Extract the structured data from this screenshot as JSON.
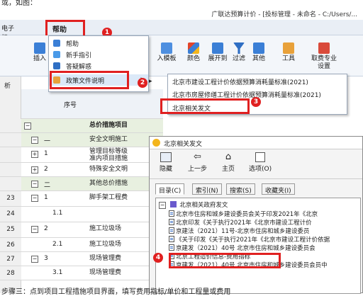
{
  "top_text": "或，如图：",
  "app_title": "广联达预算计价 - [投标管理 - 未命名 - C:/Users/...",
  "menubar": {
    "left_partial": "电子标",
    "help": "帮助",
    "f1": "F1"
  },
  "ribbon": {
    "insert": "插入",
    "template": "入模板",
    "color": "颜色",
    "expand": "展开到",
    "filter": "过滤",
    "other": "其他",
    "tools": "工具",
    "fee_setting_line1": "取费专业",
    "fee_setting_line2": "设置"
  },
  "help_menu": {
    "items": [
      "帮助",
      "新手指引",
      "答疑解惑",
      "政策文件说明"
    ]
  },
  "submenu": {
    "items": [
      "北京市建设工程计价依据预算消耗量标准(2021)",
      "北京市房屋修缮工程计价依据预算消耗量标准(2021)",
      "北京相关发文"
    ]
  },
  "badges": [
    "1",
    "2",
    "3",
    "4"
  ],
  "left_strip": {
    "label": "析"
  },
  "grid": {
    "header": "序号",
    "rows": [
      {
        "num": "",
        "code": "",
        "name": "总价措施项目",
        "toggle": "−"
      },
      {
        "num": "",
        "code": "一",
        "name": "安全文明施工",
        "toggle": "−"
      },
      {
        "num": "",
        "code": "1",
        "name": "管理目标等级\n准内项目措施",
        "toggle": "+"
      },
      {
        "num": "",
        "code": "2",
        "name": "特殊安全文明",
        "toggle": "+"
      },
      {
        "num": "",
        "code": "二",
        "name": "其他总价措施",
        "toggle": "−"
      },
      {
        "num": "23",
        "code": "1",
        "name": "脚手架工程费",
        "toggle": "−"
      },
      {
        "num": "24",
        "code": "1.1",
        "name": "",
        "toggle": ""
      },
      {
        "num": "25",
        "code": "2",
        "name": "施工垃圾场",
        "toggle": "−"
      },
      {
        "num": "26",
        "code": "2.1",
        "name": "施工垃圾场",
        "toggle": ""
      },
      {
        "num": "27",
        "code": "3",
        "name": "现场管理费",
        "toggle": "−"
      },
      {
        "num": "28",
        "code": "3.1",
        "name": "现场管理费",
        "toggle": ""
      }
    ]
  },
  "help_window": {
    "title": "北京相关发文",
    "tools": [
      "隐藏",
      "上一步",
      "主页",
      "选项(O)"
    ],
    "tabs": [
      "目录(C)",
      "索引(N)",
      "搜索(S)",
      "收藏夹(I)"
    ],
    "tree_root": "北京相关政府发文",
    "tree_items": [
      "北京市住房和城乡建设委员会关于印发2021年《北京",
      "北京印发《关于执行2021年《北京市建设工程计价",
      "京建法（2021）11号-北京市住房和城乡建设委员",
      "《关于印发《关于执行2021年《北京市建设工程计价依据",
      "京建发（2021）40号 北京市住房和城乡建设委员会",
      "北京工程造价信息-费用指标",
      "京建发（2021）40号 北京市住房和城乡建设委员会员中"
    ]
  },
  "bottom_text": "步骤三：点到项目工程措施项目界面，填写费用指标/单价和工程量或费用"
}
